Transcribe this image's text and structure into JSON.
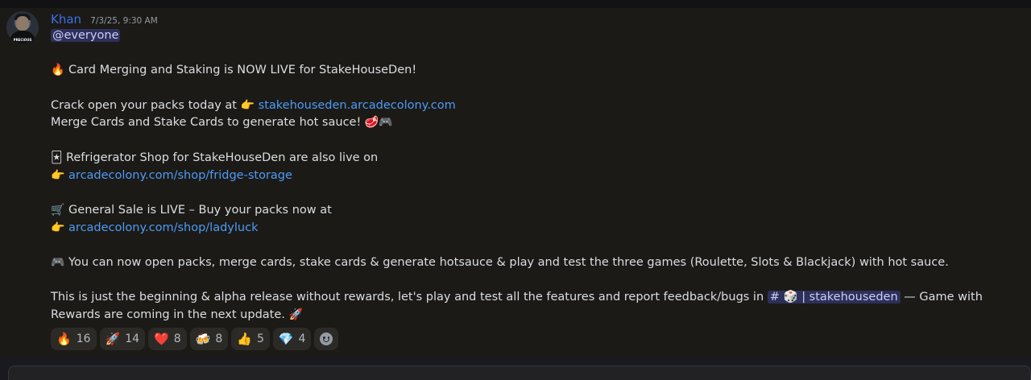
{
  "message": {
    "author": "Khan",
    "timestamp": "7/3/25, 9:30 AM",
    "avatar_label": "PRECIOUS",
    "mention": "@everyone",
    "line1_emoji": "🔥",
    "line1_text": "Card Merging and Staking is NOW LIVE for StakeHouseDen!",
    "line2_text": "Crack open your packs today at",
    "line2_emoji": "👉",
    "line2_link": "stakehouseden.arcadecolony.com",
    "line3_text": "Merge Cards and Stake Cards to generate hot sauce!",
    "line3_emojis": "🥩🎮",
    "line4_emoji": "🃏",
    "line4_text": "Refrigerator Shop for StakeHouseDen are also live on",
    "line5_emoji": "👉",
    "line5_link": "arcadecolony.com/shop/fridge-storage",
    "line6_emoji": "🛒",
    "line6_text": "General Sale is LIVE – Buy your packs now at",
    "line7_emoji": "👉",
    "line7_link": "arcadecolony.com/shop/ladyluck",
    "line8_emoji": "🎮",
    "line8_text": "You can now open packs, merge cards, stake cards & generate hotsauce & play and test the three games (Roulette, Slots & Blackjack) with hot sauce.",
    "line9_text_a": "This is just the beginning & alpha release without rewards, let's play and test all the features and report feedback/bugs in",
    "channel_label": "# 🎲 | stakehouseden",
    "line9_text_b": "— Game with Rewards are coming in the next update.",
    "line9_emoji": "🚀"
  },
  "reactions": [
    {
      "emoji": "🔥",
      "count": "16"
    },
    {
      "emoji": "🚀",
      "count": "14"
    },
    {
      "emoji": "❤️",
      "count": "8"
    },
    {
      "emoji": "🍻",
      "count": "8"
    },
    {
      "emoji": "👍",
      "count": "5"
    },
    {
      "emoji": "💎",
      "count": "4"
    }
  ]
}
